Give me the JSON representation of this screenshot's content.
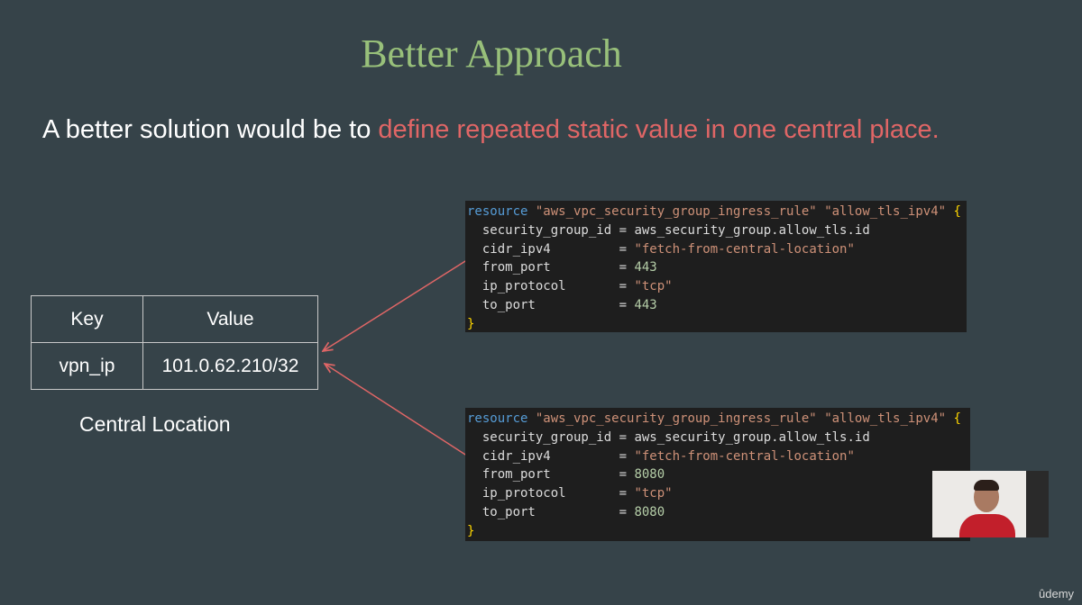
{
  "slide": {
    "title": "Better Approach",
    "subtitle_prefix": "A better solution would be to ",
    "subtitle_highlight": "define repeated static value in one central place."
  },
  "table": {
    "headers": [
      "Key",
      "Value"
    ],
    "rows": [
      [
        "vpn_ip",
        "101.0.62.210/32"
      ]
    ],
    "caption": "Central Location"
  },
  "code_blocks": [
    {
      "resource_kw": "resource",
      "type": "\"aws_vpc_security_group_ingress_rule\"",
      "name": "\"allow_tls_ipv4\"",
      "open": "{",
      "close": "}",
      "lines": [
        {
          "key": "security_group_id",
          "eq": " = ",
          "value": "aws_security_group.allow_tls.id",
          "kind": "ref"
        },
        {
          "key": "cidr_ipv4        ",
          "eq": " = ",
          "value": "\"fetch-from-central-location\"",
          "kind": "str"
        },
        {
          "key": "from_port        ",
          "eq": " = ",
          "value": "443",
          "kind": "num"
        },
        {
          "key": "ip_protocol      ",
          "eq": " = ",
          "value": "\"tcp\"",
          "kind": "str"
        },
        {
          "key": "to_port          ",
          "eq": " = ",
          "value": "443",
          "kind": "num"
        }
      ]
    },
    {
      "resource_kw": "resource",
      "type": "\"aws_vpc_security_group_ingress_rule\"",
      "name": "\"allow_tls_ipv4\"",
      "open": "{",
      "close": "}",
      "lines": [
        {
          "key": "security_group_id",
          "eq": " = ",
          "value": "aws_security_group.allow_tls.id",
          "kind": "ref"
        },
        {
          "key": "cidr_ipv4        ",
          "eq": " = ",
          "value": "\"fetch-from-central-location\"",
          "kind": "str"
        },
        {
          "key": "from_port        ",
          "eq": " = ",
          "value": "8080",
          "kind": "num"
        },
        {
          "key": "ip_protocol      ",
          "eq": " = ",
          "value": "\"tcp\"",
          "kind": "str"
        },
        {
          "key": "to_port          ",
          "eq": " = ",
          "value": "8080",
          "kind": "num"
        }
      ]
    }
  ],
  "branding": {
    "logo": "ûdemy"
  },
  "colors": {
    "title": "#98c07a",
    "highlight": "#e06666",
    "arrow": "#e06666",
    "background": "#364349"
  }
}
